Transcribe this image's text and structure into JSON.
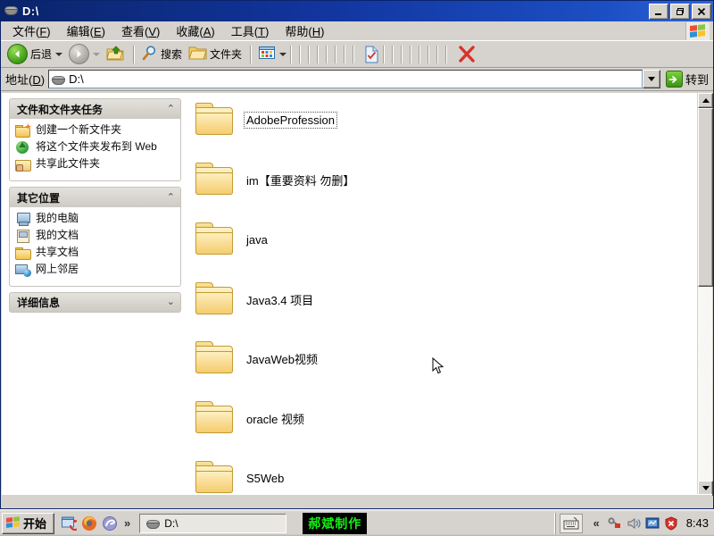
{
  "window": {
    "title": "D:\\",
    "icon": "drive-icon",
    "buttons": {
      "minimize": "_",
      "restore": "□",
      "close": "✕"
    }
  },
  "menubar": {
    "items": [
      {
        "label": "文件(F)",
        "pre": "文件(",
        "key": "F",
        "post": ")"
      },
      {
        "label": "编辑(E)",
        "pre": "编辑(",
        "key": "E",
        "post": ")"
      },
      {
        "label": "查看(V)",
        "pre": "查看(",
        "key": "V",
        "post": ")"
      },
      {
        "label": "收藏(A)",
        "pre": "收藏(",
        "key": "A",
        "post": ")"
      },
      {
        "label": "工具(T)",
        "pre": "工具(",
        "key": "T",
        "post": ")"
      },
      {
        "label": "帮助(H)",
        "pre": "帮助(",
        "key": "H",
        "post": ")"
      }
    ],
    "logo": "windows-flag-icon"
  },
  "toolbar": {
    "back_label": "后退",
    "back_icon": "back-arrow-icon",
    "forward_icon": "forward-arrow-icon",
    "up_icon": "up-folder-icon",
    "search_label": "搜索",
    "search_icon": "magnifier-icon",
    "folders_label": "文件夹",
    "folders_icon": "folder-icon",
    "views_icon": "views-icon",
    "checked_document_icon": "checked-document-icon",
    "delete_icon": "red-x-icon"
  },
  "addressbar": {
    "label": "地址(D)",
    "label_pre": "地址(",
    "label_key": "D",
    "label_post": ")",
    "value": "D:\\",
    "icon": "drive-icon",
    "dropdown_icon": "chevron-down-icon",
    "go_label": "转到",
    "go_icon": "go-arrow-icon"
  },
  "sidebar": {
    "panels": [
      {
        "title": "文件和文件夹任务",
        "chevron": "chevron-up-icon",
        "collapsed": false,
        "items": [
          {
            "label": "创建一个新文件夹",
            "icon": "new-folder-icon"
          },
          {
            "label": "将这个文件夹发布到 Web",
            "icon": "publish-web-icon"
          },
          {
            "label": "共享此文件夹",
            "icon": "share-folder-icon"
          }
        ]
      },
      {
        "title": "其它位置",
        "chevron": "chevron-up-icon",
        "collapsed": false,
        "items": [
          {
            "label": "我的电脑",
            "icon": "my-computer-icon"
          },
          {
            "label": "我的文档",
            "icon": "my-documents-icon"
          },
          {
            "label": "共享文档",
            "icon": "shared-documents-icon"
          },
          {
            "label": "网上邻居",
            "icon": "network-places-icon"
          }
        ]
      },
      {
        "title": "详细信息",
        "chevron": "chevron-down-icon",
        "collapsed": true,
        "items": []
      }
    ]
  },
  "filelist": {
    "view": "tiles",
    "items": [
      {
        "name": "AdobeProfession",
        "icon": "folder-icon",
        "focused": true
      },
      {
        "name": "im【重要资料 勿删】",
        "icon": "folder-icon",
        "focused": false
      },
      {
        "name": "java",
        "icon": "folder-icon",
        "focused": false
      },
      {
        "name": "Java3.4 项目",
        "icon": "folder-icon",
        "focused": false
      },
      {
        "name": "JavaWeb视频",
        "icon": "folder-icon",
        "focused": false
      },
      {
        "name": "oracle 视频",
        "icon": "folder-icon",
        "focused": false
      },
      {
        "name": "S5Web",
        "icon": "folder-icon",
        "focused": false
      }
    ],
    "scrollbar": {
      "up_icon": "triangle-up-icon",
      "down_icon": "triangle-down-icon"
    }
  },
  "taskbar": {
    "start_label": "开始",
    "start_icon": "windows-flag-icon",
    "quicklaunch": [
      {
        "icon": "show-desktop-icon"
      },
      {
        "icon": "firefox-icon"
      },
      {
        "icon": "browser-icon"
      }
    ],
    "quicklaunch_overflow": "»",
    "tasks": [
      {
        "label": "D:\\",
        "icon": "drive-icon"
      }
    ],
    "watermark": "郝斌制作",
    "tray": {
      "ime_icon": "keyboard-icon",
      "expand_icon": "«",
      "icons": [
        {
          "icon": "key-flag-icon"
        },
        {
          "icon": "volume-icon"
        },
        {
          "icon": "network-monitor-icon"
        },
        {
          "icon": "security-shield-icon"
        }
      ],
      "time": "8:43"
    }
  },
  "colors": {
    "title_bar": "#0a246a",
    "face": "#d6d3ce",
    "folder": "#f4cd6c",
    "accent_green": "#3a9212",
    "watermark_text": "#14f014"
  }
}
